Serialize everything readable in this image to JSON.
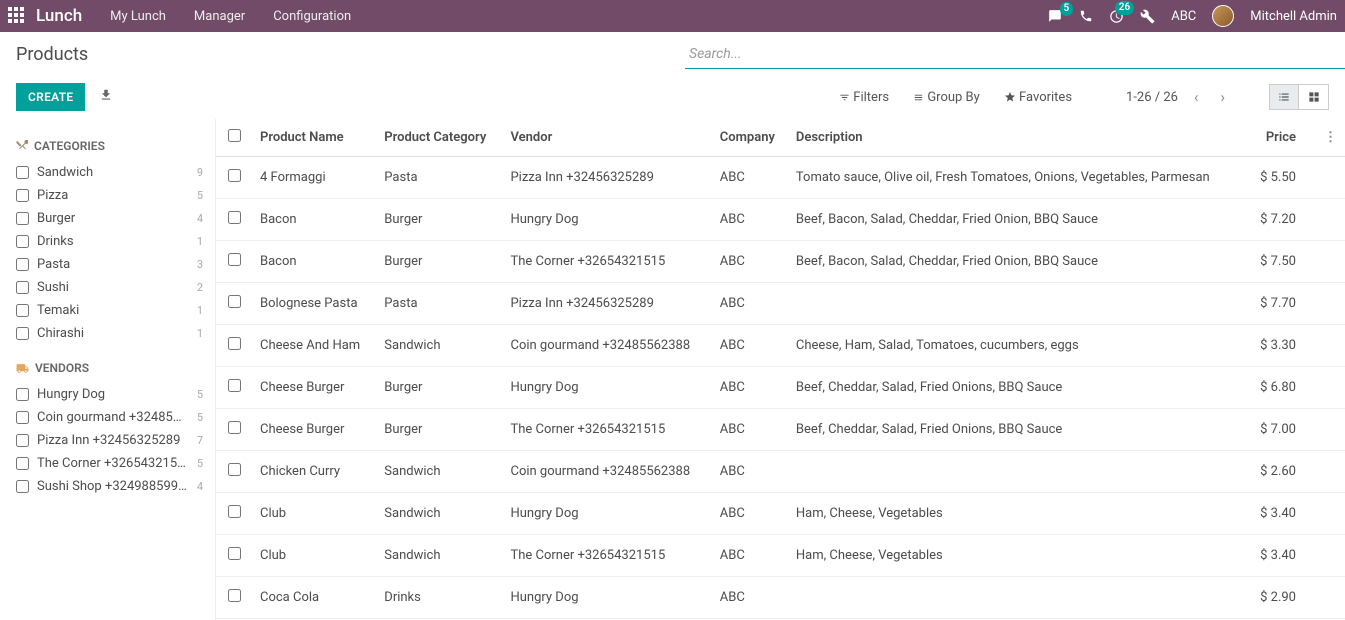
{
  "app": {
    "title": "Lunch"
  },
  "nav": {
    "my_lunch": "My Lunch",
    "manager": "Manager",
    "configuration": "Configuration"
  },
  "topright": {
    "msg_badge": "5",
    "activity_badge": "26",
    "company": "ABC",
    "user": "Mitchell Admin"
  },
  "page": {
    "title": "Products",
    "create": "CREATE"
  },
  "search": {
    "placeholder": "Search..."
  },
  "filters": {
    "filters": "Filters",
    "group_by": "Group By",
    "favorites": "Favorites",
    "pager": "1-26 / 26"
  },
  "sidebar": {
    "categories_label": "CATEGORIES",
    "vendors_label": "VENDORS",
    "categories": [
      {
        "label": "Sandwich",
        "count": "9"
      },
      {
        "label": "Pizza",
        "count": "5"
      },
      {
        "label": "Burger",
        "count": "4"
      },
      {
        "label": "Drinks",
        "count": "1"
      },
      {
        "label": "Pasta",
        "count": "3"
      },
      {
        "label": "Sushi",
        "count": "2"
      },
      {
        "label": "Temaki",
        "count": "1"
      },
      {
        "label": "Chirashi",
        "count": "1"
      }
    ],
    "vendors": [
      {
        "label": "Hungry Dog",
        "count": "5"
      },
      {
        "label": "Coin gourmand +324855...",
        "count": "5"
      },
      {
        "label": "Pizza Inn +32456325289",
        "count": "7"
      },
      {
        "label": "The Corner +326543215...",
        "count": "5"
      },
      {
        "label": "Sushi Shop +324988599...",
        "count": "4"
      }
    ]
  },
  "table": {
    "headers": {
      "name": "Product Name",
      "category": "Product Category",
      "vendor": "Vendor",
      "company": "Company",
      "description": "Description",
      "price": "Price"
    },
    "rows": [
      {
        "name": "4 Formaggi",
        "category": "Pasta",
        "vendor": "Pizza Inn +32456325289",
        "company": "ABC",
        "description": "Tomato sauce, Olive oil, Fresh Tomatoes, Onions, Vegetables, Parmesan",
        "price": "$ 5.50"
      },
      {
        "name": "Bacon",
        "category": "Burger",
        "vendor": "Hungry Dog",
        "company": "ABC",
        "description": "Beef, Bacon, Salad, Cheddar, Fried Onion, BBQ Sauce",
        "price": "$ 7.20"
      },
      {
        "name": "Bacon",
        "category": "Burger",
        "vendor": "The Corner +32654321515",
        "company": "ABC",
        "description": "Beef, Bacon, Salad, Cheddar, Fried Onion, BBQ Sauce",
        "price": "$ 7.50"
      },
      {
        "name": "Bolognese Pasta",
        "category": "Pasta",
        "vendor": "Pizza Inn +32456325289",
        "company": "ABC",
        "description": "",
        "price": "$ 7.70"
      },
      {
        "name": "Cheese And Ham",
        "category": "Sandwich",
        "vendor": "Coin gourmand +32485562388",
        "company": "ABC",
        "description": "Cheese, Ham, Salad, Tomatoes, cucumbers, eggs",
        "price": "$ 3.30"
      },
      {
        "name": "Cheese Burger",
        "category": "Burger",
        "vendor": "Hungry Dog",
        "company": "ABC",
        "description": "Beef, Cheddar, Salad, Fried Onions, BBQ Sauce",
        "price": "$ 6.80"
      },
      {
        "name": "Cheese Burger",
        "category": "Burger",
        "vendor": "The Corner +32654321515",
        "company": "ABC",
        "description": "Beef, Cheddar, Salad, Fried Onions, BBQ Sauce",
        "price": "$ 7.00"
      },
      {
        "name": "Chicken Curry",
        "category": "Sandwich",
        "vendor": "Coin gourmand +32485562388",
        "company": "ABC",
        "description": "",
        "price": "$ 2.60"
      },
      {
        "name": "Club",
        "category": "Sandwich",
        "vendor": "Hungry Dog",
        "company": "ABC",
        "description": "Ham, Cheese, Vegetables",
        "price": "$ 3.40"
      },
      {
        "name": "Club",
        "category": "Sandwich",
        "vendor": "The Corner +32654321515",
        "company": "ABC",
        "description": "Ham, Cheese, Vegetables",
        "price": "$ 3.40"
      },
      {
        "name": "Coca Cola",
        "category": "Drinks",
        "vendor": "Hungry Dog",
        "company": "ABC",
        "description": "",
        "price": "$ 2.90"
      }
    ]
  }
}
